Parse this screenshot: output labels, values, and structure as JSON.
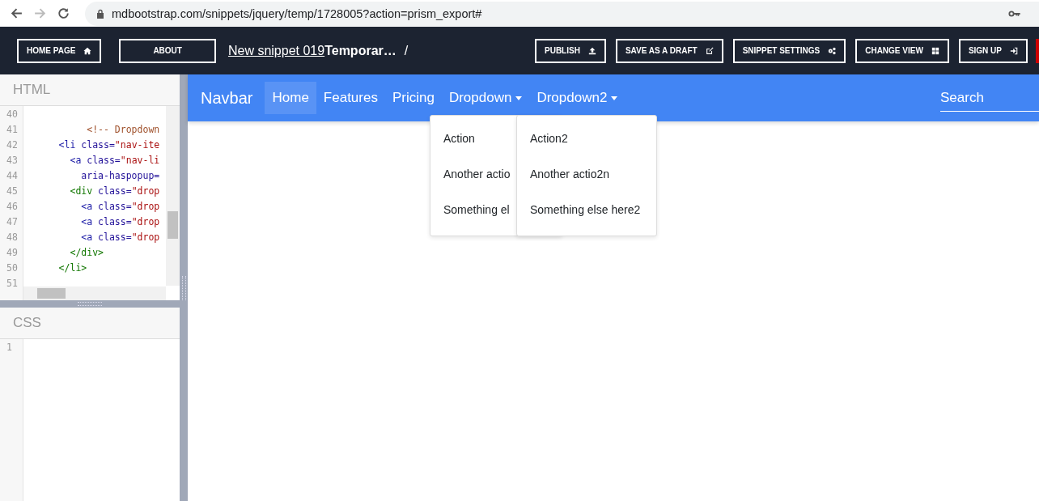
{
  "browser": {
    "url": "mdbootstrap.com/snippets/jquery/temp/1728005?action=prism_export#"
  },
  "header": {
    "left_buttons": [
      {
        "label": "HOME PAGE"
      },
      {
        "label": "ABOUT"
      }
    ],
    "snippet_link": "New snippet 019",
    "snippet_name": "Temporar…",
    "separator": "/",
    "right_buttons": [
      {
        "label": "PUBLISH"
      },
      {
        "label": "SAVE AS A DRAFT"
      },
      {
        "label": "SNIPPET SETTINGS"
      },
      {
        "label": "CHANGE VIEW"
      },
      {
        "label": "SIGN UP"
      }
    ]
  },
  "editors": [
    {
      "title": "HTML",
      "lines": [
        {
          "number": "40"
        },
        {
          "number": "41",
          "tokens": [
            {
              "kind": "comment",
              "text": "          <!-- Dropdown"
            }
          ]
        },
        {
          "number": "42",
          "tokens": [
            {
              "kind": "tag",
              "text": "     <li"
            },
            {
              "kind": "attr",
              "text": " class="
            },
            {
              "kind": "string",
              "text": "\"nav-ite"
            }
          ]
        },
        {
          "number": "43",
          "tokens": [
            {
              "kind": "tag",
              "text": "       <a"
            },
            {
              "kind": "attr",
              "text": " class="
            },
            {
              "kind": "string",
              "text": "\"nav-li"
            }
          ]
        },
        {
          "number": "44",
          "tokens": [
            {
              "kind": "attr",
              "text": "         aria-haspopup="
            }
          ]
        },
        {
          "number": "45",
          "tokens": [
            {
              "kind": "ctag",
              "text": "       <div"
            },
            {
              "kind": "attr",
              "text": " class="
            },
            {
              "kind": "string",
              "text": "\"drop"
            }
          ]
        },
        {
          "number": "46",
          "tokens": [
            {
              "kind": "tag",
              "text": "         <a"
            },
            {
              "kind": "attr",
              "text": " class="
            },
            {
              "kind": "string",
              "text": "\"drop"
            }
          ]
        },
        {
          "number": "47",
          "tokens": [
            {
              "kind": "tag",
              "text": "         <a"
            },
            {
              "kind": "attr",
              "text": " class="
            },
            {
              "kind": "string",
              "text": "\"drop"
            }
          ]
        },
        {
          "number": "48",
          "tokens": [
            {
              "kind": "tag",
              "text": "         <a"
            },
            {
              "kind": "attr",
              "text": " class="
            },
            {
              "kind": "string",
              "text": "\"drop"
            }
          ]
        },
        {
          "number": "49",
          "tokens": [
            {
              "kind": "ctag",
              "text": "       </div>"
            }
          ]
        },
        {
          "number": "50",
          "tokens": [
            {
              "kind": "ctag",
              "text": "     </li>"
            }
          ]
        },
        {
          "number": "51"
        }
      ]
    },
    {
      "title": "CSS",
      "lines": [
        {
          "number": "1"
        }
      ]
    }
  ],
  "preview": {
    "brand": "Navbar",
    "nav_items": [
      {
        "label": "Home",
        "selected": true
      },
      {
        "label": "Features",
        "selected": false
      },
      {
        "label": "Pricing",
        "selected": false
      },
      {
        "label": "Dropdown",
        "selected": false,
        "dropdown": true
      },
      {
        "label": "Dropdown2",
        "selected": false,
        "dropdown": true
      }
    ],
    "search": {
      "placeholder": "Search"
    },
    "menus": [
      {
        "items": [
          "Action",
          "Another actio",
          "Something el"
        ]
      },
      {
        "items": [
          "Action2",
          "Another actio2n",
          "Something else here2"
        ]
      }
    ]
  }
}
